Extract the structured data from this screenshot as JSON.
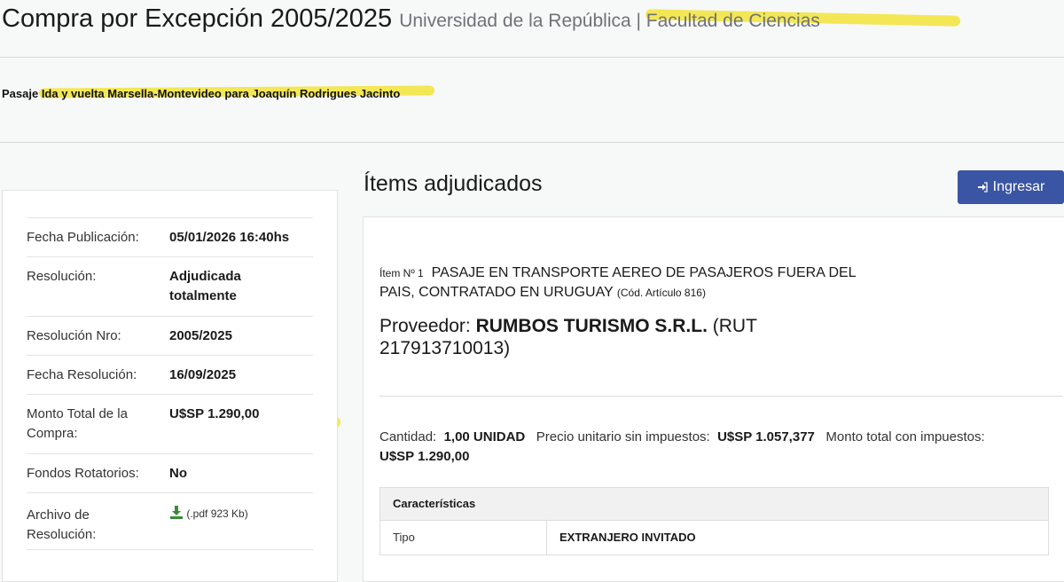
{
  "header": {
    "title": "Compra por Excepción 2005/2025",
    "subtitle": "Universidad de la República | Facultad de Ciencias"
  },
  "description": "Pasaje Ida y vuelta Marsella-Montevideo para Joaquín Rodrigues Jacinto",
  "details": [
    {
      "label": "Fecha Publicación:",
      "value": "05/01/2026 16:40hs"
    },
    {
      "label": "Resolución:",
      "value": "Adjudicada totalmente"
    },
    {
      "label": "Resolución Nro:",
      "value": "2005/2025"
    },
    {
      "label": "Fecha Resolución:",
      "value": "16/09/2025"
    },
    {
      "label": "Monto Total de la Compra:",
      "value": "U$SP 1.290,00"
    },
    {
      "label": "Fondos Rotatorios:",
      "value": "No"
    },
    {
      "label": "Archivo de Resolución:",
      "value": "(.pdf 923 Kb)"
    }
  ],
  "section_title": "Ítems adjudicados",
  "login_button": "Ingresar",
  "item": {
    "prefix": "Ítem Nº 1",
    "name": "PASAJE EN TRANSPORTE AEREO DE PASAJEROS FUERA DEL PAIS, CONTRATADO EN URUGUAY",
    "code": "(Cód. Artículo 816)",
    "provider_label": "Proveedor:",
    "provider_name": "RUMBOS TURISMO S.R.L.",
    "provider_rut": "(RUT 217913710013)",
    "quantity_label": "Cantidad:",
    "quantity_value": "1,00 UNIDAD",
    "unit_price_label": "Precio unitario sin impuestos:",
    "unit_price_value": "U$SP 1.057,377",
    "total_label": "Monto total con impuestos:",
    "total_value": "U$SP 1.290,00",
    "characteristics": {
      "header": "Características",
      "rows": [
        {
          "key": "Tipo",
          "value": "EXTRANJERO INVITADO"
        }
      ]
    }
  },
  "colors": {
    "accent": "#3a55a4",
    "highlight": "#f2e43a",
    "download_icon": "#3c8a3c"
  },
  "icons": {
    "login": "sign-in-icon",
    "download": "download-icon"
  }
}
